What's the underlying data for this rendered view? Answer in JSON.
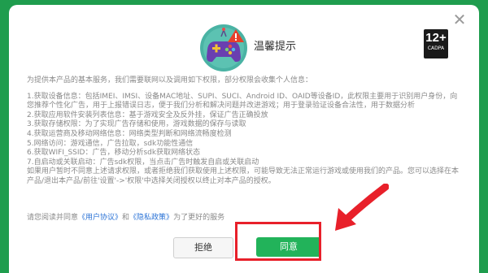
{
  "dialog": {
    "title": "温馨提示",
    "close_glyph": "✕",
    "age_rating": {
      "age": "12+",
      "caption": "CADPA"
    },
    "intro": "为提供本产品的基本服务，我们需要联网以及调用如下权限，部分权限会收集个人信息：",
    "items": [
      "1.获取设备信息：包括IMEI、IMSI、设备MAC地址、SUPI、SUCI、Android ID、OAID等设备ID，此权限主要用于识别用户身份，向您推荐个性化广告，用于上报错误日志，便于我们分析和解决问题并改进游戏；用于登录验证设备合法性，用于数据分析",
      "2.获取应用软件安装列表信息：基于游戏安全及反外挂，保证广告正确投放",
      "3.获取存储权限：为了实现广告存储和使用，游戏数据的保存与读取",
      "4.获取运营商及移动网络信息：网络类型判断和网络流畅度检测",
      "5.网络访问：游戏通信，广告拉取，sdk功能性通信",
      "6.获取WIFI_SSID：广告，移动分析sdk获取网络状态",
      "7.自启动或关联启动：广告sdk权限，当点击广告时触发自启或关联启动",
      "如果用户暂时不同意上述请求权限，或者拒绝我们获取使用上述权限，可能导致无法正常运行游戏或使用我们的产品。您可以选择在本产品/退出本产品/前往'设置'->'权限'中选择关闭授权以终止对本产品的授权。"
    ],
    "consent": {
      "prefix": "请您阅读并同意",
      "user_agreement": "《用户协议》",
      "and": "和",
      "privacy_policy": "《隐私政策》",
      "suffix": "为了更好的服务"
    },
    "buttons": {
      "reject": "拒绝",
      "agree": "同意"
    }
  },
  "colors": {
    "background": "#1f9d4e",
    "agree_button": "#22b35a",
    "link": "#2b73d6",
    "annotation_red": "#e8202a"
  }
}
